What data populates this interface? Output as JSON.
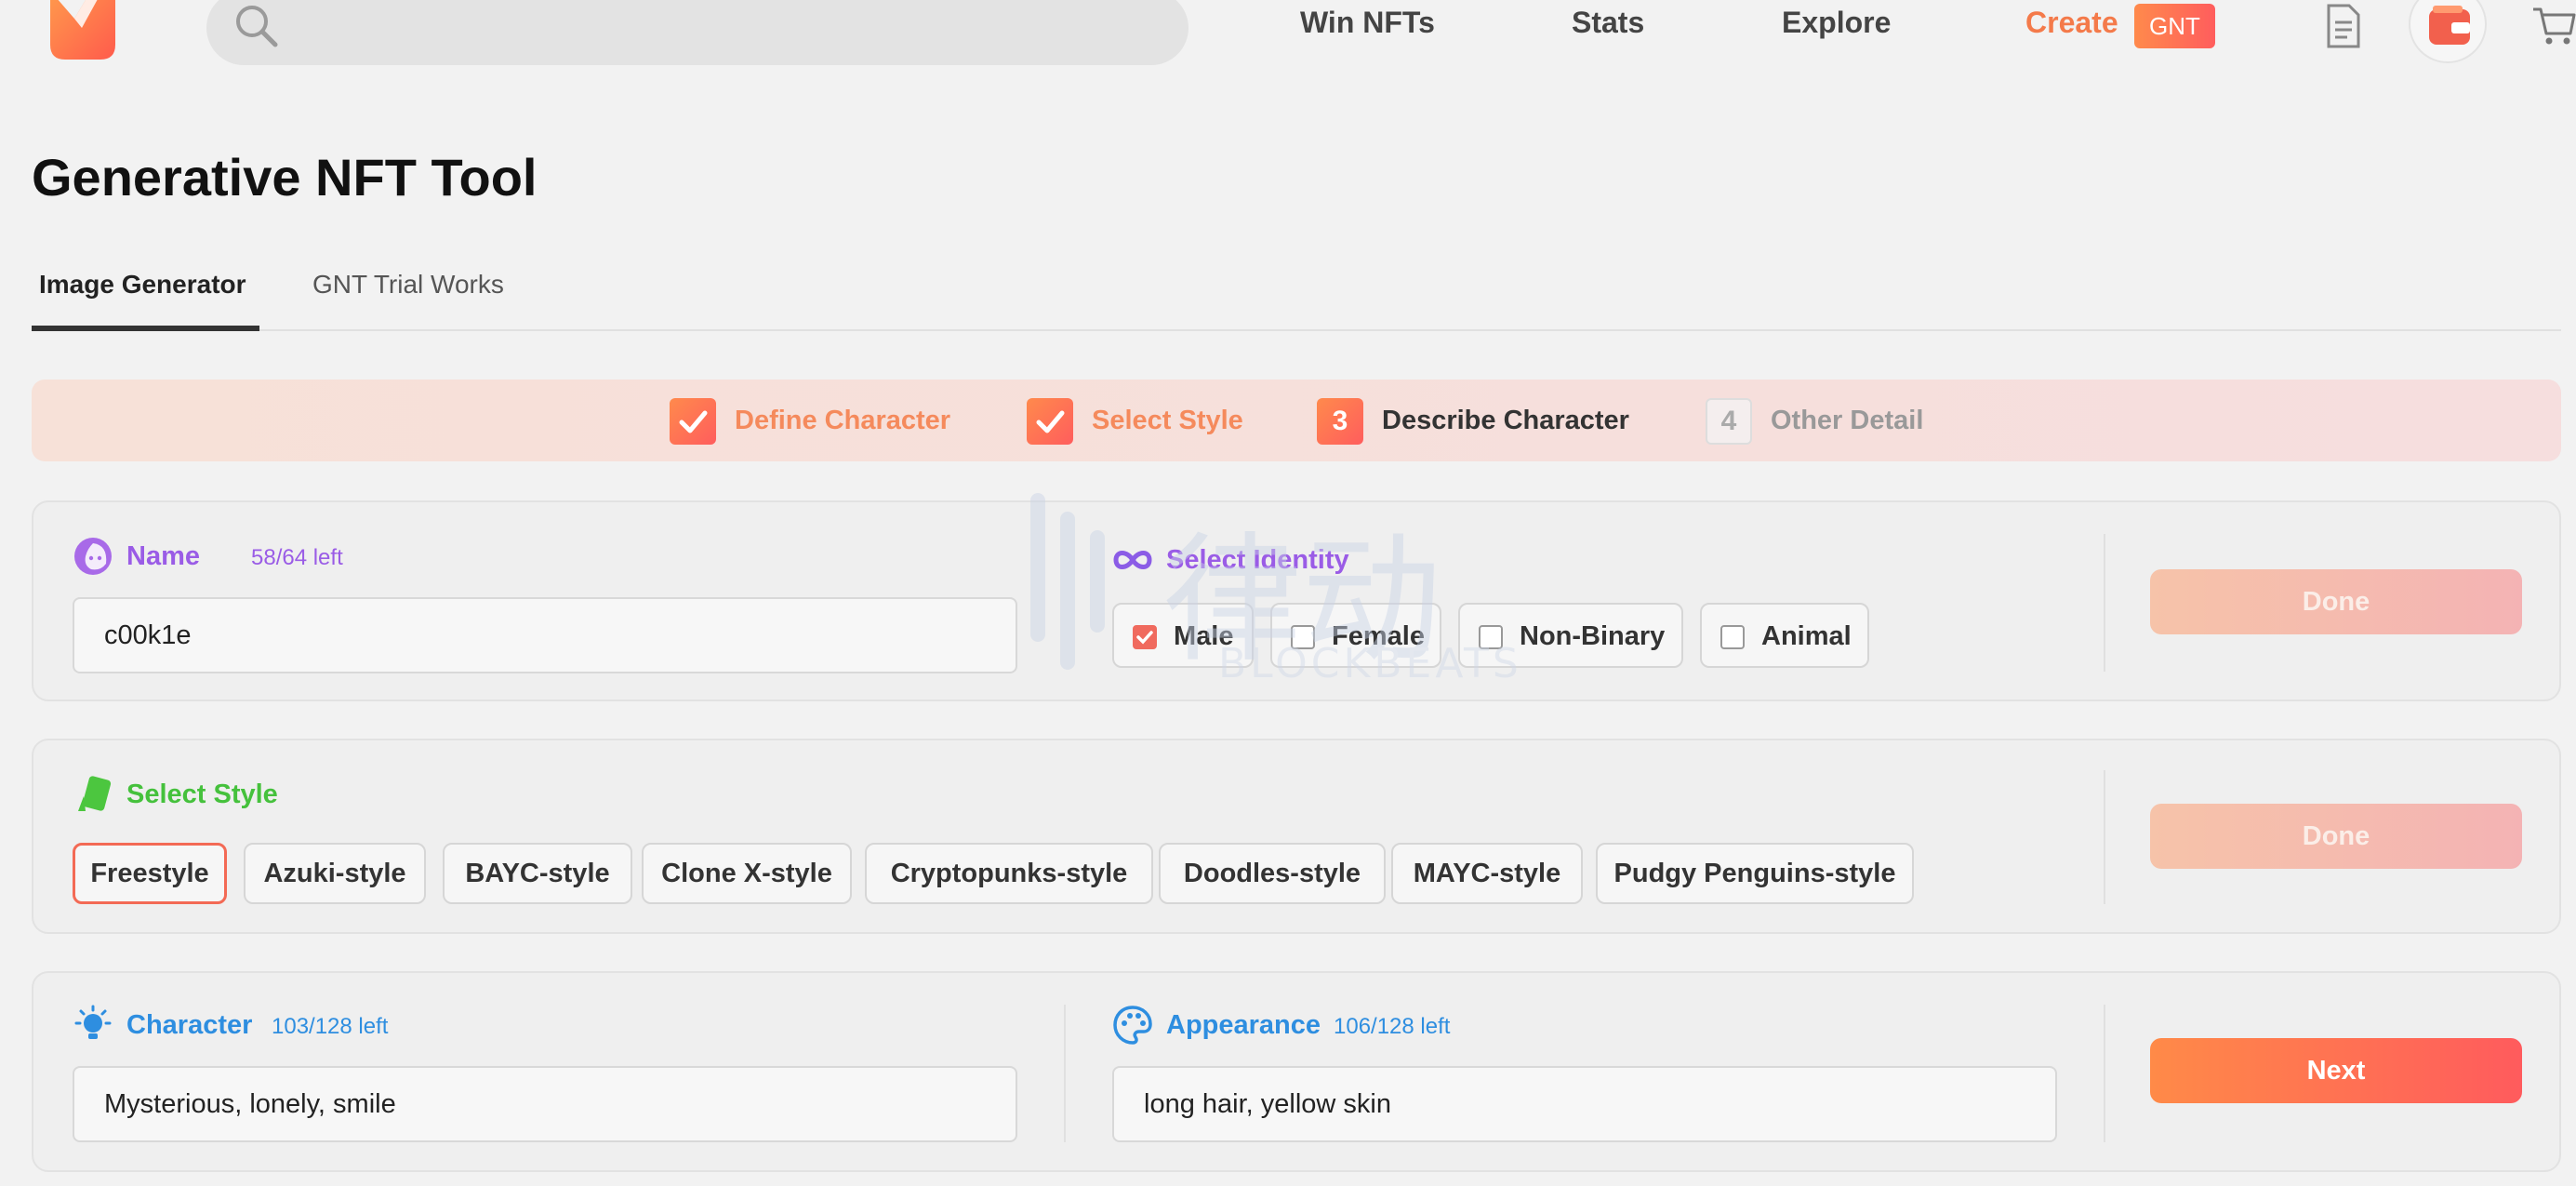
{
  "nav": {
    "search_placeholder": "",
    "items": [
      "Win NFTs",
      "Stats",
      "Explore"
    ],
    "create_label": "Create",
    "badge": "GNT"
  },
  "page": {
    "title": "Generative NFT Tool",
    "tabs": [
      "Image Generator",
      "GNT Trial Works"
    ]
  },
  "stepper": {
    "steps": [
      {
        "mark": "",
        "label": "Define Character",
        "state": "done"
      },
      {
        "mark": "",
        "label": "Select Style",
        "state": "done"
      },
      {
        "mark": "3",
        "label": "Describe Character",
        "state": "current"
      },
      {
        "mark": "4",
        "label": "Other Detail",
        "state": "todo"
      }
    ]
  },
  "define": {
    "name_label": "Name",
    "name_count": "58/64 left",
    "name_value": "c00k1e",
    "identity_label": "Select Identity",
    "identities": [
      {
        "label": "Male",
        "checked": true
      },
      {
        "label": "Female",
        "checked": false
      },
      {
        "label": "Non-Binary",
        "checked": false
      },
      {
        "label": "Animal",
        "checked": false
      }
    ],
    "button": "Done"
  },
  "style": {
    "label": "Select Style",
    "options": [
      "Freestyle",
      "Azuki-style",
      "BAYC-style",
      "Clone X-style",
      "Cryptopunks-style",
      "Doodles-style",
      "MAYC-style",
      "Pudgy Penguins-style"
    ],
    "selected": "Freestyle",
    "button": "Done"
  },
  "describe": {
    "character_label": "Character",
    "character_count": "103/128 left",
    "character_value": "Mysterious, lonely, smile",
    "appearance_label": "Appearance",
    "appearance_count": "106/128 left",
    "appearance_value": "long hair, yellow skin",
    "button": "Next"
  },
  "watermark": {
    "main": "律动",
    "sub": "BLOCKBEATS"
  },
  "colors": {
    "accent": "#f47a4a",
    "purple": "#9a5ce6",
    "green": "#45c13c",
    "blue": "#2e8ee0"
  },
  "icons": [
    "search-icon",
    "document-icon",
    "wallet-icon",
    "cart-icon",
    "character-face-icon",
    "infinity-icon",
    "style-tag-icon",
    "lightbulb-icon",
    "palette-icon"
  ]
}
